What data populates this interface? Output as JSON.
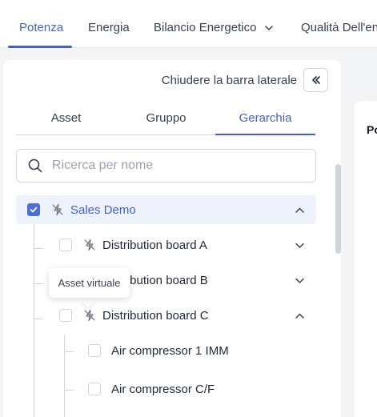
{
  "top_tabs": [
    {
      "label": "Potenza",
      "active": true
    },
    {
      "label": "Energia"
    },
    {
      "label": "Bilancio Energetico",
      "icon": "chevron-down-icon"
    },
    {
      "label": "Qualità Dell'en"
    }
  ],
  "sidebar": {
    "collapse_label": "Chiudere la barra laterale",
    "collapse_icon": "double-chevron-left-icon",
    "tabs": [
      {
        "label": "Asset"
      },
      {
        "label": "Gruppo"
      },
      {
        "label": "Gerarchia",
        "active": true
      }
    ],
    "search": {
      "placeholder": "Ricerca per nome",
      "value": ""
    },
    "tree": [
      {
        "label": "Sales Demo",
        "checked": true,
        "selected": true,
        "expanded": true,
        "icon": "virtual-asset-icon"
      },
      {
        "label": "Distribution board A",
        "checked": false,
        "expanded": false,
        "icon": "virtual-asset-icon"
      },
      {
        "label": "Distribution board B",
        "checked": false,
        "expanded": false,
        "icon": "virtual-asset-icon"
      },
      {
        "label": "Distribution board C",
        "checked": false,
        "expanded": true,
        "icon": "virtual-asset-icon"
      },
      {
        "label": "Air compressor 1 IMM",
        "checked": false
      },
      {
        "label": "Air compressor C/F",
        "checked": false
      }
    ],
    "tooltip": "Asset virtuale"
  },
  "right_panel": {
    "title_partial": "Po"
  },
  "colors": {
    "accent": "#4361c9",
    "selected_bg": "#eef2fb",
    "checkbox_checked": "#4a6fd8"
  }
}
